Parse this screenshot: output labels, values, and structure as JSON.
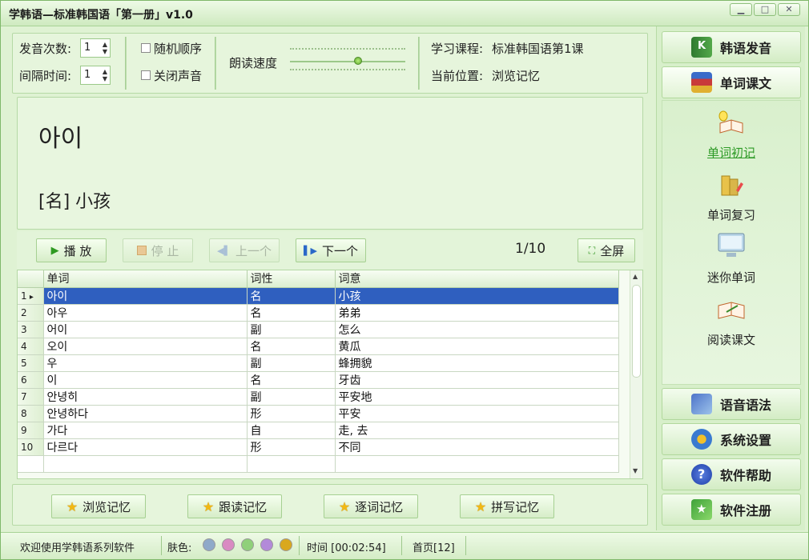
{
  "window": {
    "title": "学韩语—标准韩国语「第一册」v1.0"
  },
  "settings": {
    "pronounce_count_label": "发音次数:",
    "pronounce_count_value": "1",
    "interval_label": "间隔时间:",
    "interval_value": "1",
    "random_order_label": "随机顺序",
    "mute_label": "关闭声音",
    "read_speed_label": "朗读速度",
    "read_speed_level": 0.6,
    "course_label": "学习课程:",
    "course_value": "标准韩国语第1课",
    "position_label": "当前位置:",
    "position_value": "浏览记忆"
  },
  "current_word": {
    "korean": "아이",
    "definition": "[名] 小孩"
  },
  "controls": {
    "play": "播 放",
    "stop": "停 止",
    "prev": "上一个",
    "next": "下一个",
    "counter": "1/10",
    "fullscreen": "全屏"
  },
  "table": {
    "headers": [
      "单词",
      "词性",
      "词意"
    ],
    "rows": [
      {
        "n": "1",
        "word": "아이",
        "pos": "名",
        "meaning": "小孩",
        "selected": true
      },
      {
        "n": "2",
        "word": "아우",
        "pos": "名",
        "meaning": "弟弟"
      },
      {
        "n": "3",
        "word": "어이",
        "pos": "副",
        "meaning": "怎么"
      },
      {
        "n": "4",
        "word": "오이",
        "pos": "名",
        "meaning": "黄瓜"
      },
      {
        "n": "5",
        "word": "우",
        "pos": "副",
        "meaning": "蜂拥貌"
      },
      {
        "n": "6",
        "word": "이",
        "pos": "名",
        "meaning": "牙齿"
      },
      {
        "n": "7",
        "word": "안녕히",
        "pos": "副",
        "meaning": "平安地"
      },
      {
        "n": "8",
        "word": "안녕하다",
        "pos": "形",
        "meaning": "平安"
      },
      {
        "n": "9",
        "word": "가다",
        "pos": "自",
        "meaning": "走, 去"
      },
      {
        "n": "10",
        "word": "다르다",
        "pos": "形",
        "meaning": "不同"
      }
    ]
  },
  "modes": [
    "浏览记忆",
    "跟读记忆",
    "逐词记忆",
    "拼写记忆"
  ],
  "sidebar": {
    "top_buttons": [
      {
        "label": "韩语发音",
        "icon": "book-k-icon"
      },
      {
        "label": "单词课文",
        "icon": "books-stack-icon"
      }
    ],
    "sub_items": [
      {
        "label": "单词初记",
        "icon": "book-bulb-icon",
        "active": true
      },
      {
        "label": "单词复习",
        "icon": "books-review-icon"
      },
      {
        "label": "迷你单词",
        "icon": "monitor-icon"
      },
      {
        "label": "阅读课文",
        "icon": "open-book-icon"
      }
    ],
    "bottom_buttons": [
      {
        "label": "语音语法",
        "icon": "media-icon"
      },
      {
        "label": "系统设置",
        "icon": "gears-icon"
      },
      {
        "label": "软件帮助",
        "icon": "help-icon"
      },
      {
        "label": "软件注册",
        "icon": "register-icon"
      }
    ]
  },
  "status": {
    "welcome": "欢迎使用学韩语系列软件",
    "skin_label": "肤色:",
    "skin_colors": [
      "#8fa9c9",
      "#d98ac2",
      "#8fd07a",
      "#b38ad9",
      "#d9a81e"
    ],
    "time": "时间 [00:02:54]",
    "home": "首页[12]"
  }
}
